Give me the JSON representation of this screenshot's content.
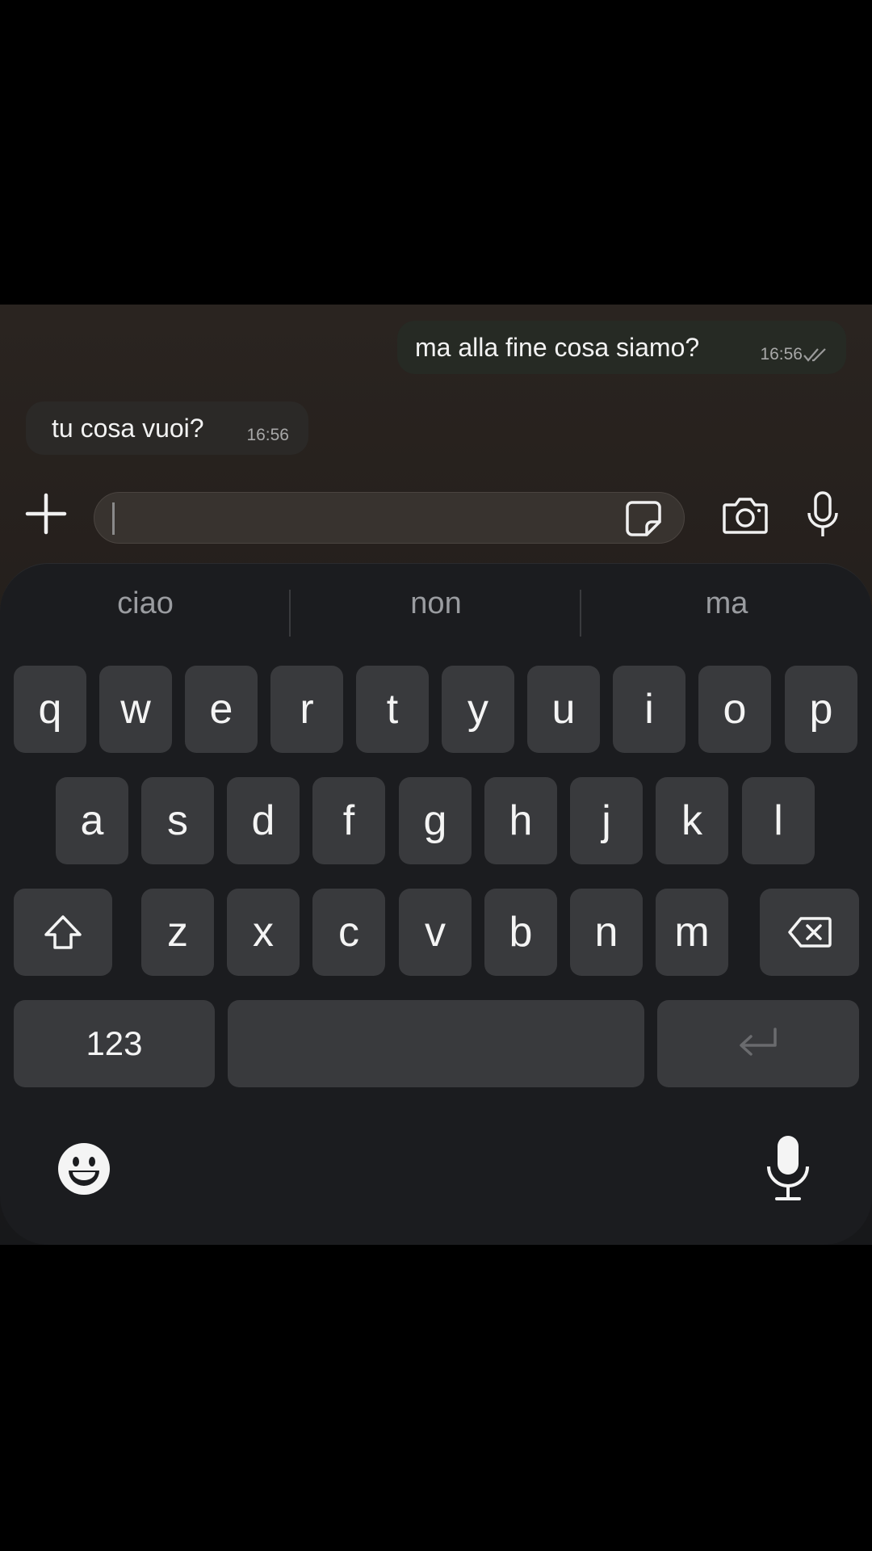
{
  "chat": {
    "outgoing": {
      "text": "ma alla fine cosa siamo?",
      "time": "16:56",
      "status": "read-double-check-icon"
    },
    "incoming": {
      "text": "tu cosa vuoi?",
      "time": "16:56"
    }
  },
  "input": {
    "value": "",
    "placeholder": ""
  },
  "keyboard": {
    "suggestions": [
      "ciao",
      "non",
      "ma"
    ],
    "row1": [
      "q",
      "w",
      "e",
      "r",
      "t",
      "y",
      "u",
      "i",
      "o",
      "p"
    ],
    "row2": [
      "a",
      "s",
      "d",
      "f",
      "g",
      "h",
      "j",
      "k",
      "l"
    ],
    "row3": [
      "z",
      "x",
      "c",
      "v",
      "b",
      "n",
      "m"
    ],
    "numbers_label": "123"
  },
  "colors": {
    "outgoing_bubble": "#262a24",
    "incoming_bubble": "#2b2927",
    "key_bg": "#393a3d",
    "keyboard_bg": "#1b1c1f"
  }
}
